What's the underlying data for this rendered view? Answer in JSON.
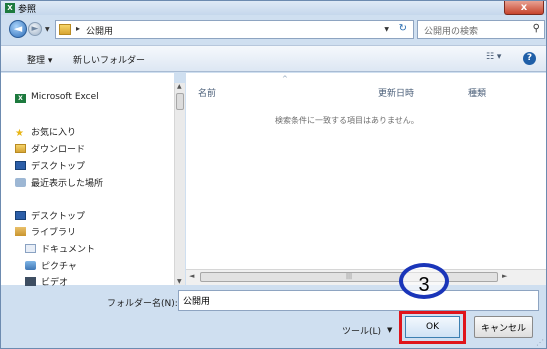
{
  "window": {
    "title": "参照",
    "title_icon": "X",
    "close_label": "x"
  },
  "address": {
    "path": "公開用",
    "separator": "▸",
    "search_placeholder": "公開用の検索"
  },
  "toolbar": {
    "organize_label": "整理 ▾",
    "new_folder_label": "新しいフォルダー",
    "view_label": "☷ ▾",
    "help_label": "?"
  },
  "sidebar": {
    "items": [
      {
        "label": "Microsoft Excel",
        "icon": "excel-icon"
      },
      {
        "label": "お気に入り",
        "icon": "star-icon"
      },
      {
        "label": "ダウンロード",
        "icon": "download-folder-icon"
      },
      {
        "label": "デスクトップ",
        "icon": "desktop-icon"
      },
      {
        "label": "最近表示した場所",
        "icon": "recent-places-icon"
      },
      {
        "label": "デスクトップ",
        "icon": "desktop-icon"
      },
      {
        "label": "ライブラリ",
        "icon": "library-icon"
      },
      {
        "label": "ドキュメント",
        "icon": "documents-icon"
      },
      {
        "label": "ピクチャ",
        "icon": "pictures-icon"
      },
      {
        "label": "ビデオ",
        "icon": "videos-icon"
      }
    ]
  },
  "file_list": {
    "columns": [
      "名前",
      "更新日時",
      "種類"
    ],
    "empty_message": "検索条件に一致する項目はありません。"
  },
  "footer": {
    "folder_name_label": "フォルダー名(N):",
    "folder_name_value": "公開用",
    "tools_label": "ツール(L)",
    "ok_label": "OK",
    "cancel_label": "キャンセル"
  },
  "annotation": {
    "step_number": "3",
    "circle_color": "#1a35b9",
    "highlight_color": "#e0141b"
  }
}
